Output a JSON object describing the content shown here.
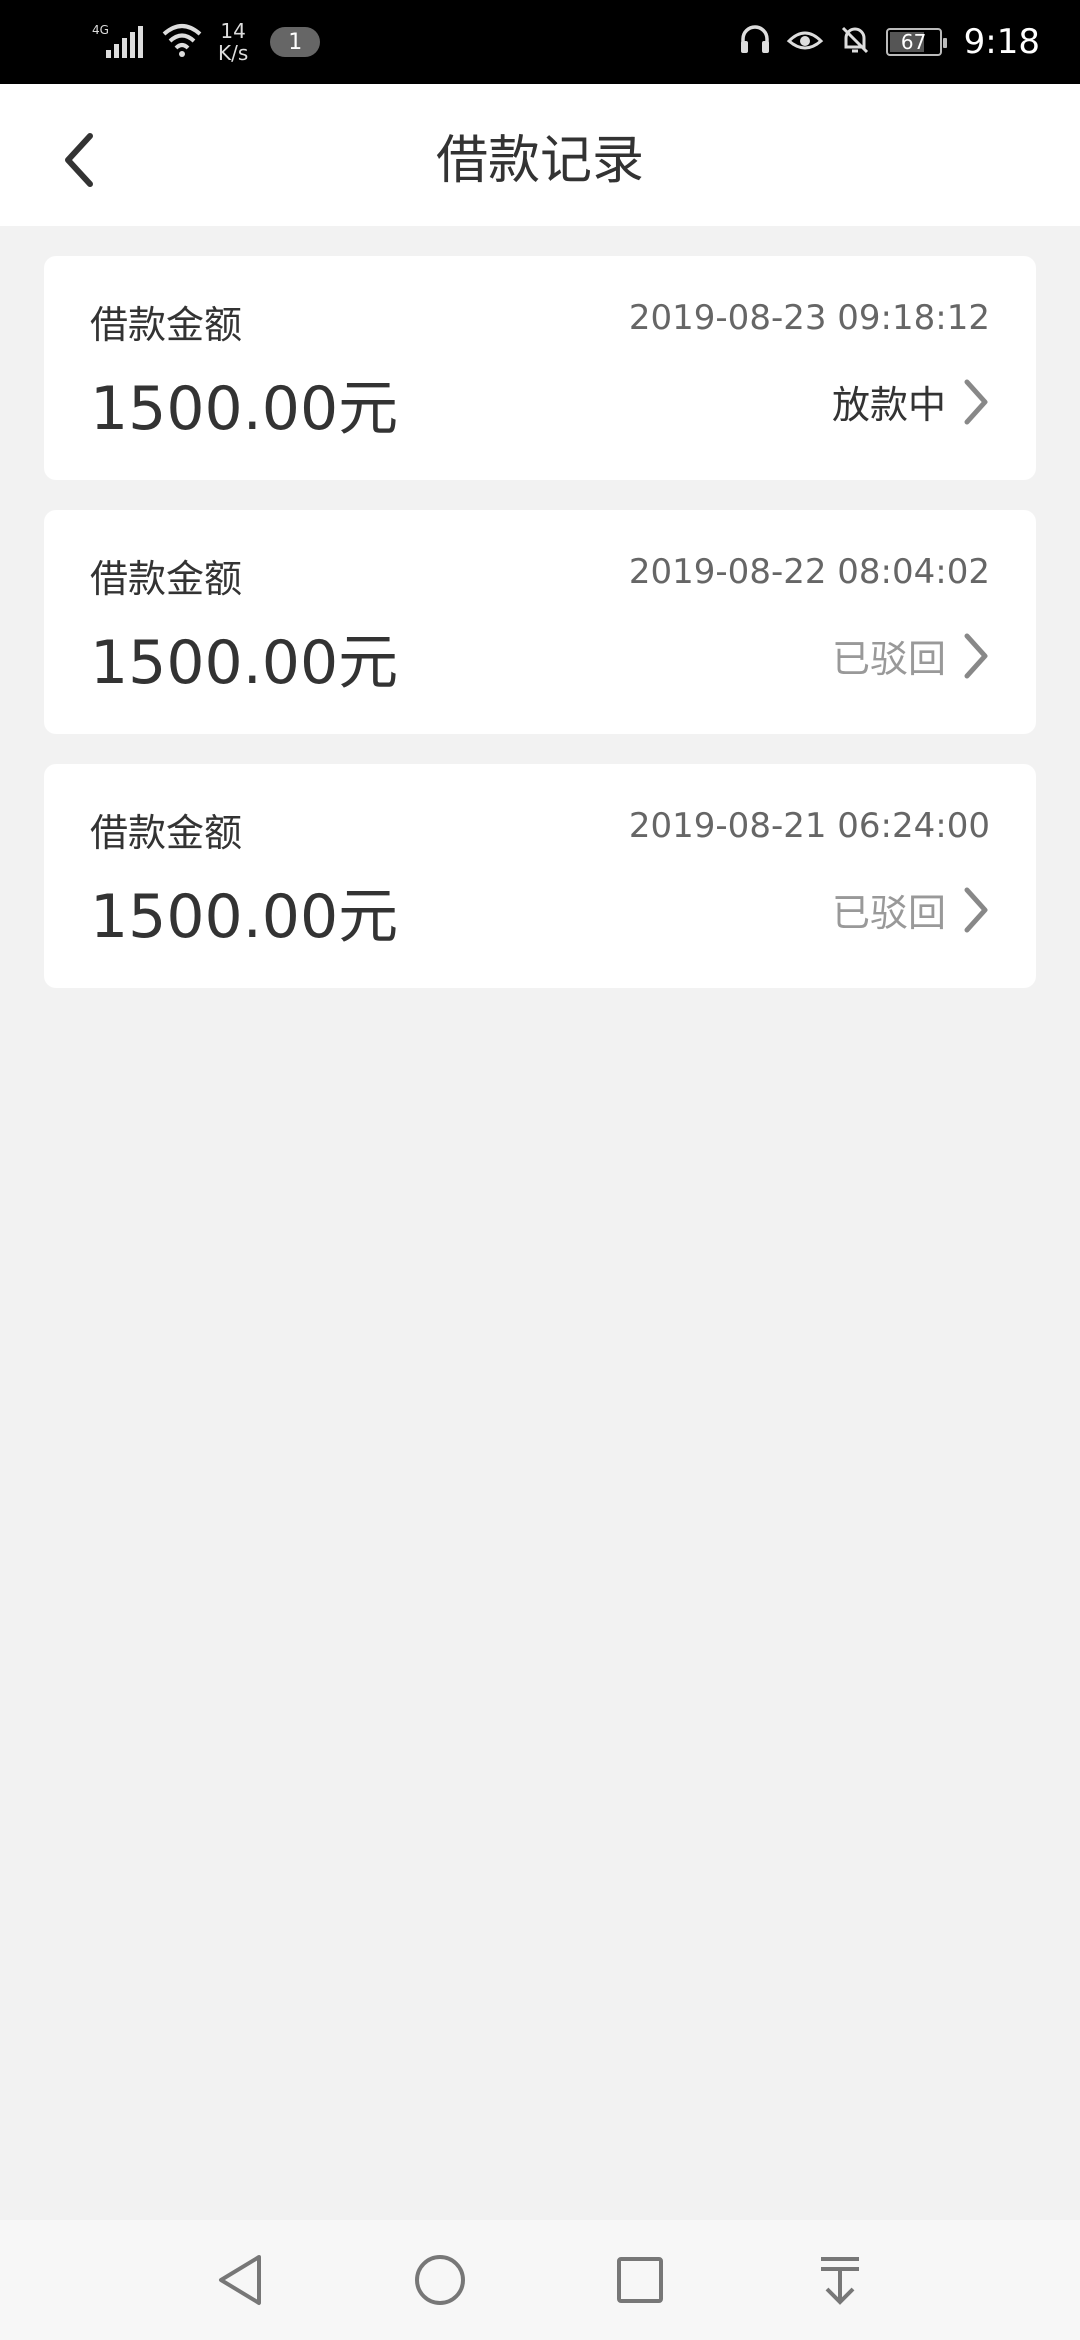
{
  "status_bar": {
    "network_type": "4G",
    "speed_value": "14",
    "speed_unit": "K/s",
    "notification_count": "1",
    "battery_level": "67",
    "time": "9:18"
  },
  "header": {
    "title": "借款记录"
  },
  "records": [
    {
      "label": "借款金额",
      "date": "2019-08-23 09:18:12",
      "amount": "1500.00元",
      "status": "放款中",
      "status_color": "#333333"
    },
    {
      "label": "借款金额",
      "date": "2019-08-22 08:04:02",
      "amount": "1500.00元",
      "status": "已驳回",
      "status_color": "#999999"
    },
    {
      "label": "借款金额",
      "date": "2019-08-21 06:24:00",
      "amount": "1500.00元",
      "status": "已驳回",
      "status_color": "#999999"
    }
  ],
  "colors": {
    "background": "#f2f2f2",
    "card": "#ffffff",
    "text_primary": "#333333",
    "text_secondary": "#666666",
    "text_muted": "#999999"
  }
}
